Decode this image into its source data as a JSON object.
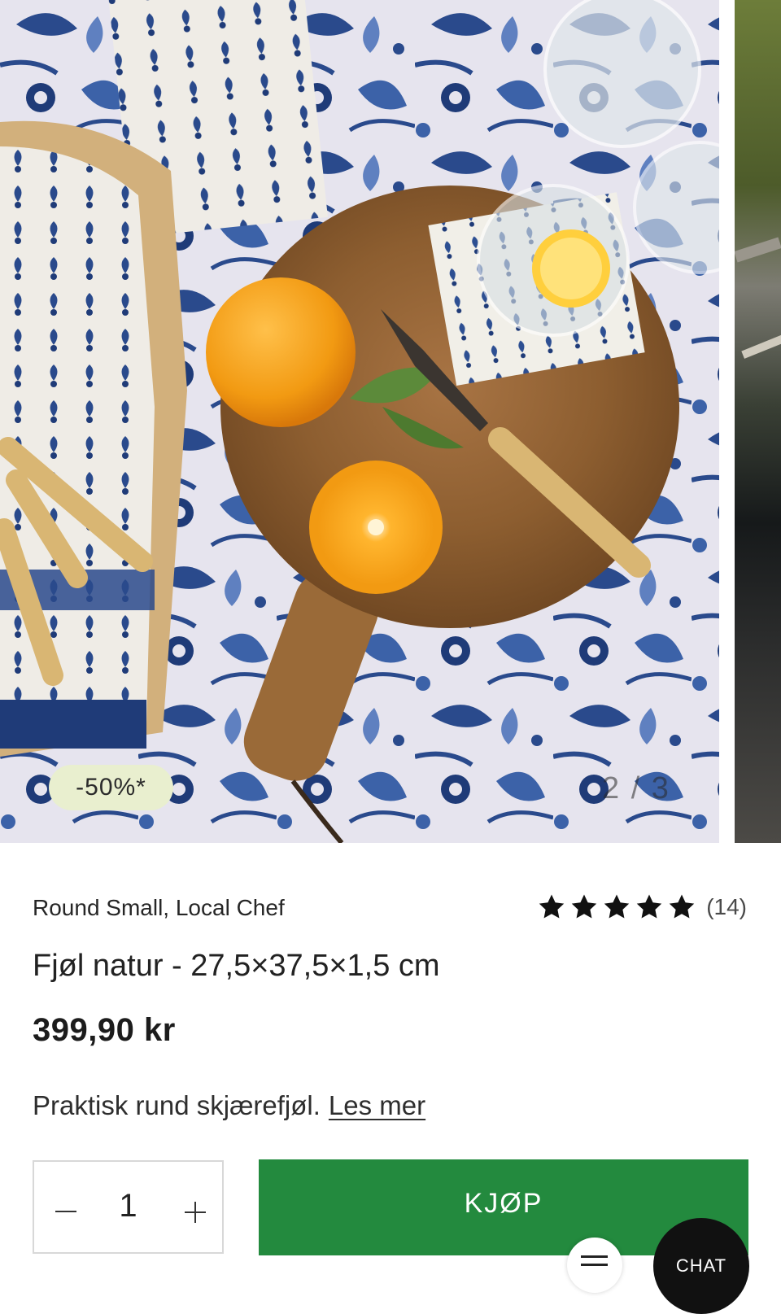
{
  "gallery": {
    "discount_badge": "-50%*",
    "counter": "2 / 3",
    "current_slide": 2,
    "total_slides": 3
  },
  "product": {
    "brand": "Round Small, Local Chef",
    "title": "Fjøl natur - 27,5×37,5×1,5 cm",
    "price": "399,90 kr",
    "description": "Praktisk rund skjærefjøl.",
    "read_more": "Les mer",
    "rating": {
      "stars": 5,
      "max": 5,
      "count": "(14)"
    }
  },
  "purchase": {
    "quantity": "1",
    "buy_label": "KJØP"
  },
  "chat": {
    "label": "CHAT"
  },
  "colors": {
    "buy_button": "#238a3e",
    "badge": "#e9efcf",
    "star": "#111111",
    "pattern_blue": "#2a4a8c",
    "board_wood": "#9a6a38"
  }
}
